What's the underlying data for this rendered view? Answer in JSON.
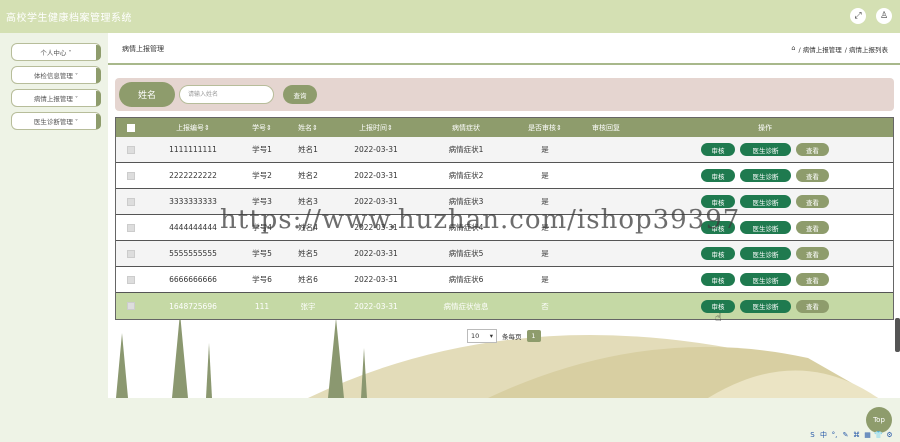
{
  "header": {
    "title": "高校学生健康档案管理系统",
    "icons": [
      "fullscreen-icon",
      "user-icon"
    ]
  },
  "sidebar": {
    "items": [
      {
        "label": "个人中心 ˅"
      },
      {
        "label": "体检信息管理 ˅"
      },
      {
        "label": "病情上报管理 ˅"
      },
      {
        "label": "医生诊断管理 ˅"
      }
    ]
  },
  "breadcrumb": {
    "title": "病情上报管理",
    "home_icon": "home-icon",
    "path": [
      "/ 病情上报管理",
      "/ 病情上报列表"
    ]
  },
  "search": {
    "label": "姓名",
    "placeholder": "请输入姓名",
    "button": "查询"
  },
  "table": {
    "headers": [
      "上报编号⇕",
      "学号⇕",
      "姓名⇕",
      "上报时间⇕",
      "病情症状",
      "是否审核⇕",
      "审核回复",
      "操作"
    ],
    "rows": [
      {
        "id": "1111111111",
        "sno": "学号1",
        "name": "姓名1",
        "time": "2022-03-31",
        "symptom": "病情症状1",
        "audit": "是"
      },
      {
        "id": "2222222222",
        "sno": "学号2",
        "name": "姓名2",
        "time": "2022-03-31",
        "symptom": "病情症状2",
        "audit": "是"
      },
      {
        "id": "3333333333",
        "sno": "学号3",
        "name": "姓名3",
        "time": "2022-03-31",
        "symptom": "病情症状3",
        "audit": "是"
      },
      {
        "id": "4444444444",
        "sno": "学号4",
        "name": "姓名4",
        "time": "2022-03-31",
        "symptom": "病情症状4",
        "audit": "是"
      },
      {
        "id": "5555555555",
        "sno": "学号5",
        "name": "姓名5",
        "time": "2022-03-31",
        "symptom": "病情症状5",
        "audit": "是"
      },
      {
        "id": "6666666666",
        "sno": "学号6",
        "name": "姓名6",
        "time": "2022-03-31",
        "symptom": "病情症状6",
        "audit": "是"
      },
      {
        "id": "1648725696",
        "sno": "111",
        "name": "张宇",
        "time": "2022-03-31",
        "symptom": "病情症状信息",
        "audit": "否"
      }
    ],
    "actions": {
      "audit": "审核",
      "diagnose": "医生诊断",
      "view": "查看"
    }
  },
  "pagination": {
    "page_size": "10",
    "total_label": "条每页",
    "current_page": "1"
  },
  "watermark": "https://www.huzhan.com/ishop39397",
  "top_button": "Top",
  "toolbar": {
    "label": "中",
    "icons": [
      "S",
      "°,",
      "✎",
      "⌘",
      "▦",
      "👕",
      "⚙"
    ]
  },
  "colors": {
    "primary": "#8e9c6c",
    "action": "#1f7a4f",
    "header": "#d4e0b3",
    "search_bg": "#e5d5d0"
  }
}
